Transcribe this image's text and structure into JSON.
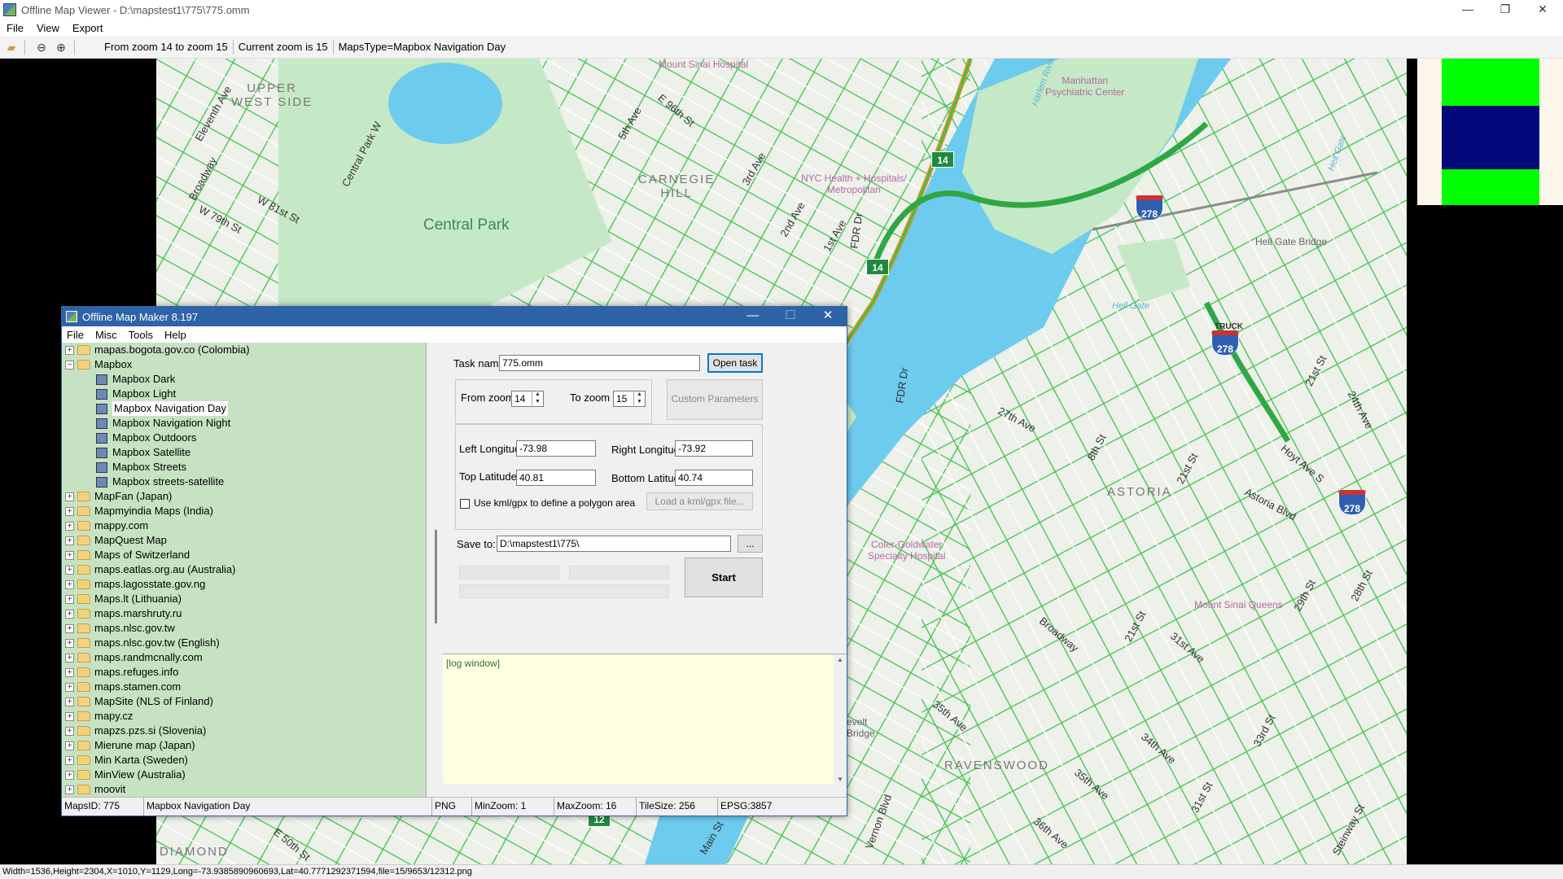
{
  "viewer": {
    "title": "Offline Map Viewer - D:\\mapstest1\\775\\775.omm",
    "menu": [
      "File",
      "View",
      "Export"
    ],
    "toolbar": {
      "zoom_range": "From zoom 14 to zoom 15",
      "current_zoom": "Current zoom is 15",
      "maps_type": "MapsType=Mapbox Navigation Day"
    },
    "controls": {
      "minimize": "—",
      "restore": "❐",
      "close": "✕"
    },
    "status_line": "Width=1536,Height=2304,X=1010,Y=1129,Long=-73.9385890960693,Lat=40.7771292371594,file=15/9653/12312.png"
  },
  "map": {
    "colors": {
      "park": "#c5e9c6",
      "water": "#6dcbee",
      "land": "#eef0ea",
      "road_traffic": "#3cc34a",
      "road_slow": "#f08a2a"
    },
    "labels": {
      "eleventh_ave": "Eleventh Ave",
      "upper_west_side": "UPPER\nWEST SIDE",
      "broadway_top": "Broadway",
      "w79": "W 79th St",
      "w81": "W 81st St",
      "central_park_w": "Central Park W",
      "central_park": "Central Park",
      "mount_sinai": "Mount Sinai Hospital",
      "e96": "E 96th St",
      "fifth_ave": "5th Ave",
      "carnegie_hill": "CARNEGIE\nHILL",
      "third_ave": "3rd Ave",
      "second_ave": "2nd Ave",
      "first_ave": "1st Ave",
      "nyc_health": "NYC Health + Hospitals/\nMetropolitan",
      "fdr_dr_top": "FDR Dr",
      "fdr_dr_bottom": "FDR Dr",
      "harlem_river": "Harlem River",
      "manhattan_psych": "Manhattan\nPsychiatric Center",
      "hell_gate_bridge": "Hell Gate Bridge",
      "hell_gate": "Hell Gate",
      "hell_gate_top": "Hell Gate",
      "truck": "TRUCK",
      "st21_top": "21st St",
      "ave24": "24th Ave",
      "hoyt_ave": "Hoyt Ave S",
      "ave27": "27th Ave",
      "st8": "8th St",
      "st21_mid": "21st St",
      "astoria": "ASTORIA",
      "astoria_blvd": "Astoria Blvd",
      "coler": "Coler-Goldwater\nSpecialty Hospital",
      "mount_sinai_queens": "Mount Sinai Queens",
      "broadway_queens": "Broadway",
      "st21_low": "21st St",
      "ave31": "31st Ave",
      "st29": "29th St",
      "st28": "28th St",
      "ave35": "35th Ave",
      "ave34": "34th Ave",
      "st33": "33rd St",
      "ravenswood": "RAVENSWOOD",
      "ave35b": "35th Ave",
      "st31": "31st St",
      "ave36": "36th Ave",
      "steinway": "Steinway St",
      "vernon": "Vernon Blvd",
      "rooseveltbridge": "evelt\nBridge",
      "diamond": "DIAMOND",
      "e50": "E 50th St",
      "main_st": "Main St"
    },
    "shields": {
      "rt14_a": "14",
      "rt14_b": "14",
      "i278_a": "278",
      "i278_b": "278",
      "i278_c": "278",
      "rt12": "12"
    }
  },
  "legend": {
    "colors": [
      "#00ff00",
      "#00087a",
      "#00ff00"
    ]
  },
  "dialog": {
    "title": "Offline Map Maker 8.197",
    "menu": [
      "File",
      "Misc",
      "Tools",
      "Help"
    ],
    "tree": [
      {
        "label": "mapas.bogota.gov.co (Colombia)",
        "type": "folder",
        "exp": "+"
      },
      {
        "label": "Mapbox",
        "type": "folder",
        "exp": "−"
      },
      {
        "label": "Mapbox Dark",
        "type": "map"
      },
      {
        "label": "Mapbox Light",
        "type": "map"
      },
      {
        "label": "Mapbox Navigation Day",
        "type": "map",
        "selected": true
      },
      {
        "label": "Mapbox Navigation Night",
        "type": "map"
      },
      {
        "label": "Mapbox Outdoors",
        "type": "map"
      },
      {
        "label": "Mapbox Satellite",
        "type": "map"
      },
      {
        "label": "Mapbox Streets",
        "type": "map"
      },
      {
        "label": "Mapbox streets-satellite",
        "type": "map"
      },
      {
        "label": "MapFan (Japan)",
        "type": "folder",
        "exp": "+"
      },
      {
        "label": "Mapmyindia Maps (India)",
        "type": "folder",
        "exp": "+"
      },
      {
        "label": "mappy.com",
        "type": "folder",
        "exp": "+"
      },
      {
        "label": "MapQuest Map",
        "type": "folder",
        "exp": "+"
      },
      {
        "label": "Maps of Switzerland",
        "type": "folder",
        "exp": "+"
      },
      {
        "label": "maps.eatlas.org.au (Australia)",
        "type": "folder",
        "exp": "+"
      },
      {
        "label": "maps.lagosstate.gov.ng",
        "type": "folder",
        "exp": "+"
      },
      {
        "label": "Maps.lt (Lithuania)",
        "type": "folder",
        "exp": "+"
      },
      {
        "label": "maps.marshruty.ru",
        "type": "folder",
        "exp": "+"
      },
      {
        "label": "maps.nlsc.gov.tw",
        "type": "folder",
        "exp": "+"
      },
      {
        "label": "maps.nlsc.gov.tw (English)",
        "type": "folder",
        "exp": "+"
      },
      {
        "label": "maps.randmcnally.com",
        "type": "folder",
        "exp": "+"
      },
      {
        "label": "maps.refuges.info",
        "type": "folder",
        "exp": "+"
      },
      {
        "label": "maps.stamen.com",
        "type": "folder",
        "exp": "+"
      },
      {
        "label": "MapSite (NLS of Finland)",
        "type": "folder",
        "exp": "+"
      },
      {
        "label": "mapy.cz",
        "type": "folder",
        "exp": "+"
      },
      {
        "label": "mapzs.pzs.si (Slovenia)",
        "type": "folder",
        "exp": "+"
      },
      {
        "label": "Mierune map (Japan)",
        "type": "folder",
        "exp": "+"
      },
      {
        "label": "Min Karta (Sweden)",
        "type": "folder",
        "exp": "+"
      },
      {
        "label": "MinView (Australia)",
        "type": "folder",
        "exp": "+"
      },
      {
        "label": "moovit",
        "type": "folder",
        "exp": "+"
      }
    ],
    "form": {
      "task_name_label": "Task name",
      "task_name_value": "775.omm",
      "open_task": "Open task ...",
      "from_zoom_label": "From zoom",
      "from_zoom_value": "14",
      "to_zoom_label": "To zoom",
      "to_zoom_value": "15",
      "custom_params": "Custom Parameters",
      "left_lon_label": "Left Longitude",
      "left_lon_value": "-73.98",
      "right_lon_label": "Right Longitude",
      "right_lon_value": "-73.92",
      "top_lat_label": "Top Latitude",
      "top_lat_value": "40.81",
      "bottom_lat_label": "Bottom Latitude",
      "bottom_lat_value": "40.74",
      "use_kml_label": "Use kml/gpx to define a polygon area",
      "load_kml": "Load a kml/gpx file...",
      "save_to_label": "Save to:",
      "save_to_value": "D:\\mapstest1\\775\\",
      "browse": "...",
      "start": "Start",
      "log": "[log window]"
    },
    "status": {
      "maps_id": "MapsID: 775",
      "map_name": "Mapbox Navigation Day",
      "format": "PNG",
      "min_zoom": "MinZoom: 1",
      "max_zoom": "MaxZoom: 16",
      "tile_size": "TileSize: 256",
      "epsg": "EPSG:3857"
    }
  }
}
